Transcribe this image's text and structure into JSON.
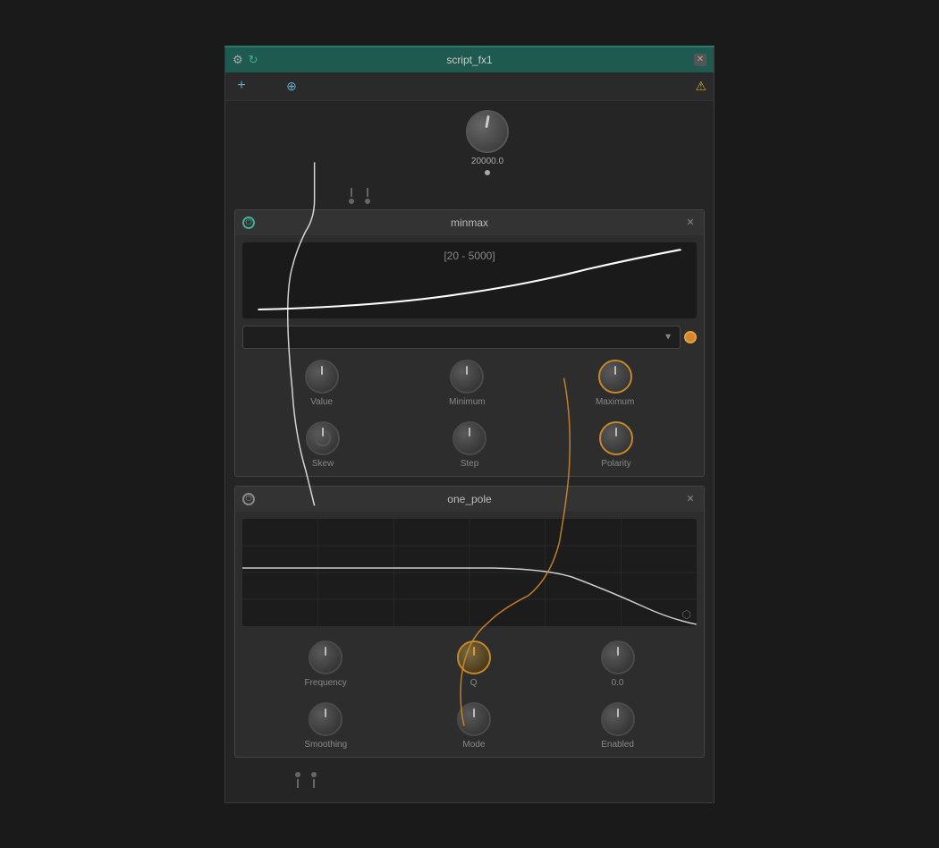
{
  "window": {
    "title": "script_fx1",
    "bg_color": "#1a1a1a"
  },
  "toolbar": {
    "add_label": "+",
    "warning_label": "⚠"
  },
  "knob_main": {
    "value": "20000.0"
  },
  "minmax_panel": {
    "title": "minmax",
    "chart_label": "[20 - 5000]",
    "knobs": [
      {
        "label": "Value"
      },
      {
        "label": "Minimum"
      },
      {
        "label": "Maximum"
      }
    ],
    "knobs2": [
      {
        "label": "Skew"
      },
      {
        "label": "Step"
      },
      {
        "label": "Polarity"
      }
    ]
  },
  "one_pole_panel": {
    "title": "one_pole",
    "knobs": [
      {
        "label": "Frequency"
      },
      {
        "label": "Q",
        "active": true
      },
      {
        "label": "0.0"
      }
    ],
    "knobs2": [
      {
        "label": "Smoothing"
      },
      {
        "label": "Mode"
      },
      {
        "label": "Enabled"
      }
    ]
  },
  "icons": {
    "power": "⏻",
    "close": "✕",
    "add": "+",
    "crosshair": "⊕",
    "warning": "⚠",
    "settings": "≡",
    "refresh": "↻",
    "dropdown_arrow": "▼",
    "export": "⬡"
  }
}
